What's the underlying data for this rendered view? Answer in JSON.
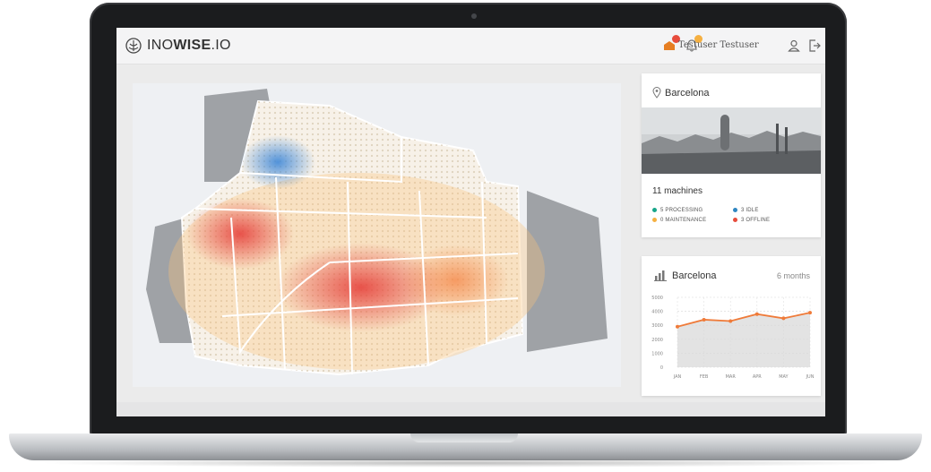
{
  "app": {
    "logo_regular": "INO",
    "logo_bold": "WISE",
    "logo_suffix": ".IO",
    "user_name": "Testuser Testuser"
  },
  "icons": [
    "logo-icon",
    "alerts-icon",
    "bell-icon",
    "user-icon",
    "logout-icon",
    "location-pin-icon",
    "bar-chart-icon"
  ],
  "colors": {
    "processing": "#17a589",
    "idle": "#2e86c1",
    "maintenance": "#f5b041",
    "offline": "#e74c3c",
    "accent": "#ef7b3a"
  },
  "location_card": {
    "city": "Barcelona",
    "machines_label": "11 machines",
    "stats": [
      {
        "label": "5 PROCESSING",
        "color": "#17a589"
      },
      {
        "label": "3 IDLE",
        "color": "#2e86c1"
      },
      {
        "label": "0 MAINTENANCE",
        "color": "#f5b041"
      },
      {
        "label": "3 OFFLINE",
        "color": "#e74c3c"
      }
    ]
  },
  "chart_card": {
    "title": "Barcelona",
    "period": "6 months"
  },
  "chart_data": {
    "type": "area",
    "categories": [
      "JAN",
      "FEB",
      "MAR",
      "APR",
      "MAY",
      "JUN"
    ],
    "values": [
      2900,
      3400,
      3300,
      3800,
      3500,
      3900
    ],
    "yticks": [
      5000,
      4000,
      3000,
      2000,
      1000,
      0
    ],
    "ylim": [
      0,
      5000
    ],
    "grid": true,
    "color": "#ef7b3a"
  }
}
